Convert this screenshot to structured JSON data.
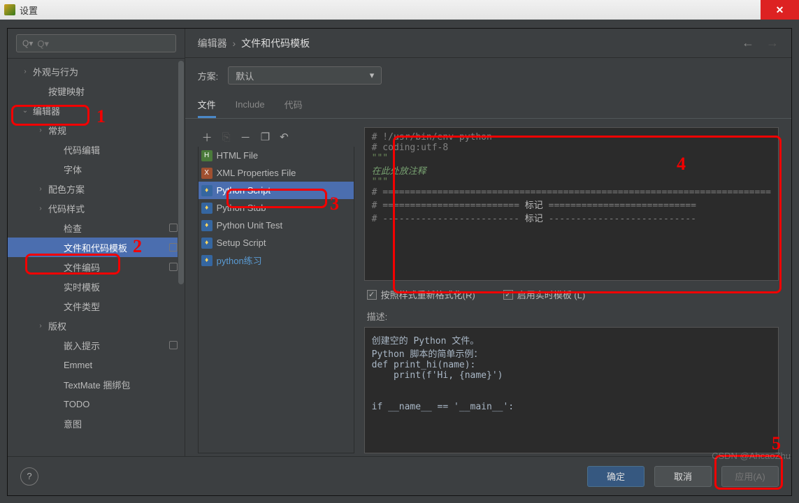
{
  "window": {
    "title": "设置"
  },
  "search": {
    "placeholder": "Q▾"
  },
  "sidebar": {
    "items": [
      {
        "label": "外观与行为",
        "chev": "›",
        "level": 1
      },
      {
        "label": "按键映射",
        "chev": "",
        "level": 2
      },
      {
        "label": "编辑器",
        "chev": "⌄",
        "level": 1
      },
      {
        "label": "常规",
        "chev": "›",
        "level": 2
      },
      {
        "label": "代码编辑",
        "chev": "",
        "level": 3
      },
      {
        "label": "字体",
        "chev": "",
        "level": 3
      },
      {
        "label": "配色方案",
        "chev": "›",
        "level": 2
      },
      {
        "label": "代码样式",
        "chev": "›",
        "level": 2
      },
      {
        "label": "检查",
        "chev": "",
        "level": 3,
        "dot": true
      },
      {
        "label": "文件和代码模板",
        "chev": "",
        "level": 3,
        "selected": true,
        "dot": true
      },
      {
        "label": "文件编码",
        "chev": "",
        "level": 3,
        "dot": true
      },
      {
        "label": "实时模板",
        "chev": "",
        "level": 3
      },
      {
        "label": "文件类型",
        "chev": "",
        "level": 3
      },
      {
        "label": "版权",
        "chev": "›",
        "level": 2
      },
      {
        "label": "嵌入提示",
        "chev": "",
        "level": 3,
        "dot": true
      },
      {
        "label": "Emmet",
        "chev": "",
        "level": 3
      },
      {
        "label": "TextMate 捆绑包",
        "chev": "",
        "level": 3
      },
      {
        "label": "TODO",
        "chev": "",
        "level": 3
      },
      {
        "label": "意图",
        "chev": "",
        "level": 3
      }
    ]
  },
  "breadcrumb": {
    "a": "编辑器",
    "b": "文件和代码模板"
  },
  "scheme": {
    "label": "方案:",
    "value": "默认"
  },
  "tabs": [
    {
      "label": "文件",
      "active": true
    },
    {
      "label": "Include",
      "active": false
    },
    {
      "label": "代码",
      "active": false
    }
  ],
  "toolbar": {
    "add": "＋",
    "copy_disabled": "⎘",
    "remove": "－",
    "copy": "❐",
    "undo": "↶"
  },
  "templates": [
    {
      "label": "HTML File",
      "icon": "html"
    },
    {
      "label": "XML Properties File",
      "icon": "xml"
    },
    {
      "label": "Python Script",
      "icon": "py",
      "selected": true
    },
    {
      "label": "Python Stub",
      "icon": "py"
    },
    {
      "label": "Python Unit Test",
      "icon": "py"
    },
    {
      "label": "Setup Script",
      "icon": "py"
    },
    {
      "label": "python练习",
      "icon": "py",
      "link": true
    }
  ],
  "code": {
    "l1": "# !/usr/bin/env python",
    "l2": "# coding:utf-8",
    "l3": "\"\"\"",
    "l4": "在此处放注释",
    "l5": "\"\"\"",
    "l6": "# =======================================================================",
    "l7a": "# ========================= ",
    "l7b": "标记",
    "l7c": " ===========================",
    "l8a": "# ------------------------- ",
    "l8b": "标记",
    "l8c": " ---------------------------"
  },
  "checks": {
    "reformat": "按照样式重新格式化(R)",
    "live": "启用实时模板 (L)"
  },
  "desc": {
    "label": "描述:",
    "l1": "创建空的 Python 文件。",
    "l2": "Python 脚本的简单示例：",
    "l3": "def print_hi(name):",
    "l4": "    print(f'Hi, {name}')",
    "l5": "",
    "l6": "",
    "l7": "if __name__ == '__main__':"
  },
  "buttons": {
    "ok": "确定",
    "cancel": "取消",
    "apply": "应用(A)"
  },
  "annotations": {
    "n1": "1",
    "n2": "2",
    "n3": "3",
    "n4": "4",
    "n5": "5"
  },
  "watermark": "CSDN @AhcaoZhu"
}
